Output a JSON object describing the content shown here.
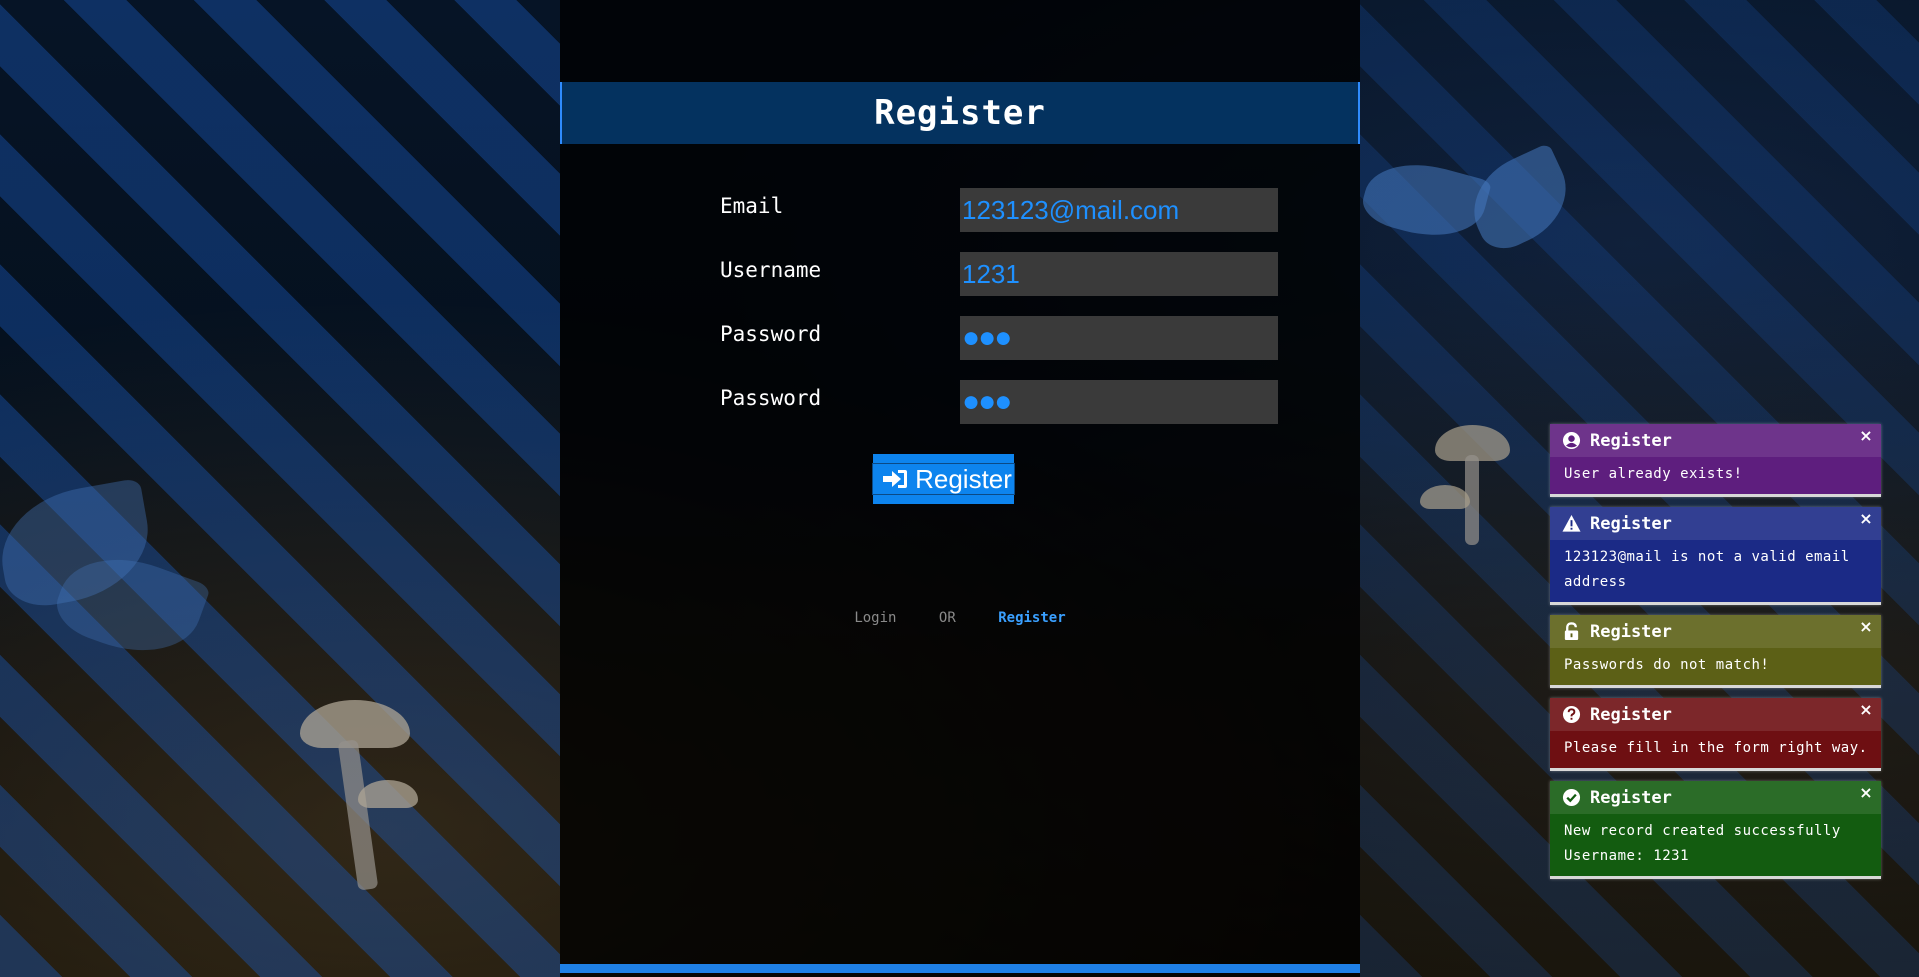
{
  "form": {
    "title": "Register",
    "fields": [
      {
        "label": "Email",
        "value": "123123@mail.com",
        "type": "text"
      },
      {
        "label": "Username",
        "value": "1231",
        "type": "text"
      },
      {
        "label": "Password",
        "value": "●●●",
        "type": "password"
      },
      {
        "label": "Password",
        "value": "●●●",
        "type": "password"
      }
    ],
    "submit_label": "Register",
    "submit_icon": "sign-in-icon"
  },
  "switch_links": {
    "login": "Login",
    "or": "OR",
    "register": "Register"
  },
  "colors": {
    "accent": "#0d84ee",
    "input_text": "#1e90ff",
    "header_bg": "#04325f"
  },
  "toasts": [
    {
      "title": "Register",
      "icon": "user-circle-icon",
      "message": "User already exists!",
      "color": "#5e1e7e",
      "close": "×"
    },
    {
      "title": "Register",
      "icon": "warning-icon",
      "message": "123123@mail is not a valid email address",
      "color": "#1b2a86",
      "close": "×"
    },
    {
      "title": "Register",
      "icon": "unlock-icon",
      "message": "Passwords do not match!",
      "color": "#5c6016",
      "close": "×"
    },
    {
      "title": "Register",
      "icon": "question-circle-icon",
      "message": "Please fill in the form right way.",
      "color": "#6e0f12",
      "close": "×"
    },
    {
      "title": "Register",
      "icon": "check-circle-icon",
      "message": "New record created successfully Username: 1231",
      "color": "#135c10",
      "close": "×"
    }
  ]
}
